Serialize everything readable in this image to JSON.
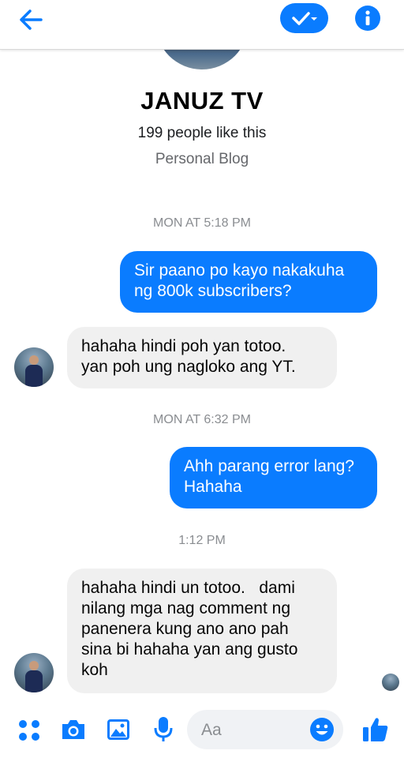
{
  "header": {
    "back_icon": "arrow-left-icon",
    "check_icon": "check-dropdown-icon",
    "info_icon": "info-icon",
    "accent_color": "#0a7cff"
  },
  "profile": {
    "name": "JANUZ TV",
    "likes": "199 people like this",
    "category": "Personal Blog"
  },
  "conversation": {
    "timestamp_1": "MON AT 5:18 PM",
    "msg_1": [
      "Sir paano po kayo nakakuha",
      "ng 800k subscribers?"
    ],
    "msg_2": [
      "hahaha hindi poh yan totoo.",
      "yan poh ung nagloko ang YT."
    ],
    "timestamp_2": "MON AT 6:32 PM",
    "msg_3": [
      "Ahh parang error lang?",
      "Hahaha"
    ],
    "timestamp_3": "1:12 PM",
    "msg_4": [
      "hahaha hindi un totoo.   dami",
      "nilang mga nag comment ng",
      "panenera kung ano ano pah",
      "sina bi hahaha yan ang gusto",
      "koh"
    ]
  },
  "composer": {
    "placeholder": "Aa",
    "icons": [
      "apps-icon",
      "camera-icon",
      "image-icon",
      "microphone-icon",
      "emoji-icon",
      "thumbs-up-icon"
    ]
  }
}
